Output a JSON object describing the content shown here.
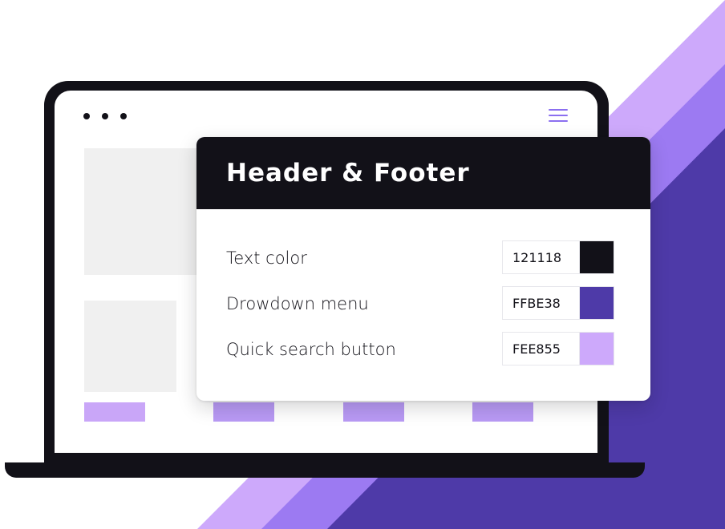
{
  "panel": {
    "title": "Header & Footer",
    "rows": [
      {
        "label": "Text color",
        "hex": "121118",
        "swatch": "#121118"
      },
      {
        "label": "Drowdown menu",
        "hex": "FFBE38",
        "swatch": "#4e3aa8"
      },
      {
        "label": "Quick search button",
        "hex": "FEE855",
        "swatch": "#cda9fb"
      }
    ]
  },
  "icons": {
    "window_dots": "three-dots-icon",
    "menu": "hamburger-menu-icon"
  },
  "colors": {
    "dark": "#121118",
    "purple_light": "#cda9fb",
    "purple_mid": "#9c7af2",
    "purple_dark": "#4e3aa8",
    "placeholder": "#f0f0f0"
  }
}
